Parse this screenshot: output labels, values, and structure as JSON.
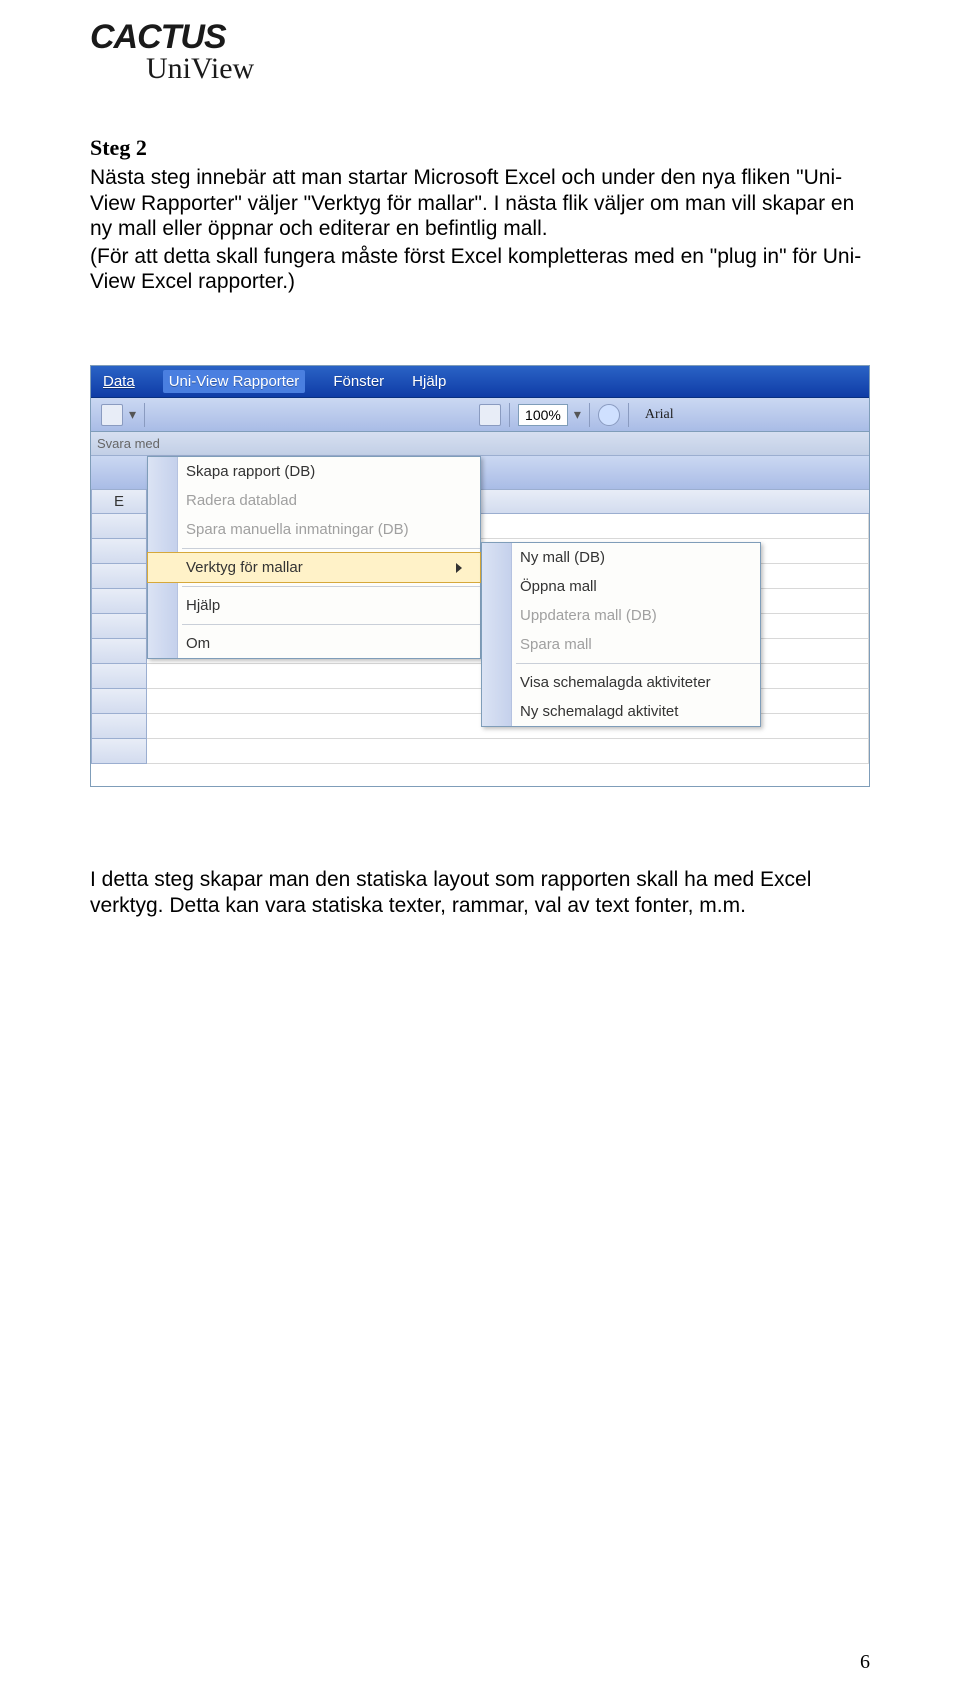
{
  "logo": {
    "line1": "CACTUS",
    "line2": "UniView"
  },
  "step_heading": "Steg 2",
  "paragraph1": "Nästa steg innebär att man startar Microsoft Excel och under den nya fliken \"Uni-View Rapporter\" väljer \"Verktyg för mallar\". I nästa flik väljer om man vill skapar en ny mall eller öppnar och editerar en befintlig mall.",
  "paragraph2": "(För att detta skall fungera måste först Excel kompletteras med en \"plug in\" för Uni-View Excel rapporter.)",
  "paragraph3": "I detta steg skapar man den statiska layout som rapporten skall ha med Excel verktyg. Detta kan vara statiska texter, rammar, val av text fonter, m.m.",
  "excel": {
    "menubar": [
      "Data",
      "Uni-View Rapporter",
      "Fönster",
      "Hjälp"
    ],
    "zoom": "100%",
    "font": "Arial",
    "svara": "Svara med",
    "colE": "E",
    "menu1": {
      "items": [
        {
          "label": "Skapa rapport (DB)",
          "disabled": false
        },
        {
          "label": "Radera datablad",
          "disabled": true
        },
        {
          "label": "Spara manuella inmatningar (DB)",
          "disabled": true
        }
      ],
      "highlight": "Verktyg för mallar",
      "items2": [
        {
          "label": "Hjälp",
          "disabled": false
        },
        {
          "label": "Om",
          "disabled": false
        }
      ]
    },
    "menu2": {
      "group1": [
        {
          "label": "Ny mall (DB)",
          "disabled": false
        },
        {
          "label": "Öppna mall",
          "disabled": false
        },
        {
          "label": "Uppdatera mall (DB)",
          "disabled": true
        },
        {
          "label": "Spara mall",
          "disabled": true
        }
      ],
      "group2": [
        {
          "label": "Visa schemalagda aktiviteter",
          "disabled": false
        },
        {
          "label": "Ny schemalagd aktivitet",
          "disabled": false
        }
      ]
    }
  },
  "page_number": "6"
}
